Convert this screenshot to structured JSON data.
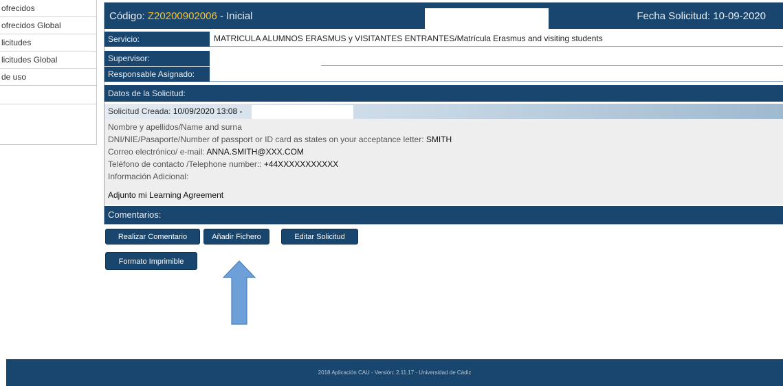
{
  "sidebar": {
    "items": [
      {
        "label": "ofrecidos"
      },
      {
        "label": "ofrecidos Global"
      },
      {
        "label": "licitudes"
      },
      {
        "label": "licitudes Global"
      },
      {
        "label": "de uso"
      }
    ]
  },
  "header": {
    "code_label": "Código: ",
    "code_value": "Z20200902006",
    "status": " - Inicial",
    "fecha": "Fecha Solicitud: 10-09-2020"
  },
  "fields": {
    "servicio_label": "Servicio:",
    "servicio_value": "MATRICULA ALUMNOS ERASMUS y VISITANTES ENTRANTES/Matrícula Erasmus and visiting students",
    "supervisor_label": "Supervisor:",
    "responsable_label": "Responsable Asignado:"
  },
  "datos": {
    "title": "Datos de la Solicitud:",
    "created_label": "Solicitud Creada: ",
    "created_value": "10/09/2020 13:08 -",
    "name_label": "Nombre y apellidos/Name and surna",
    "dni_label": "DNI/NIE/Pasaporte/Number of passport or ID card as states on your acceptance letter: ",
    "dni_value": "SMITH",
    "email_label": "Correo electrónico/ e-mail: ",
    "email_value": "ANNA.SMITH@XXX.COM",
    "phone_label": "Teléfono de contacto /Telephone number:: ",
    "phone_value": "+44XXXXXXXXXXX",
    "info_label": "Información Adicional:",
    "adjunto": "Adjunto mi Learning Agreement"
  },
  "comentarios": {
    "title": "Comentarios:"
  },
  "buttons": {
    "comentario": "Realizar Comentario",
    "fichero": "Añadir Fichero",
    "editar": "Editar Solicitud",
    "imprimible": "Formato Imprimible"
  },
  "footer": {
    "text": "2018 Aplicación CAU - Versión: 2.11.17 - Universidad de Cádiz"
  },
  "colors": {
    "primary": "#18466e",
    "code_accent": "#f2c23b",
    "arrow": "#6d9fd8"
  },
  "icons": {
    "annotation": "up-arrow-icon"
  }
}
